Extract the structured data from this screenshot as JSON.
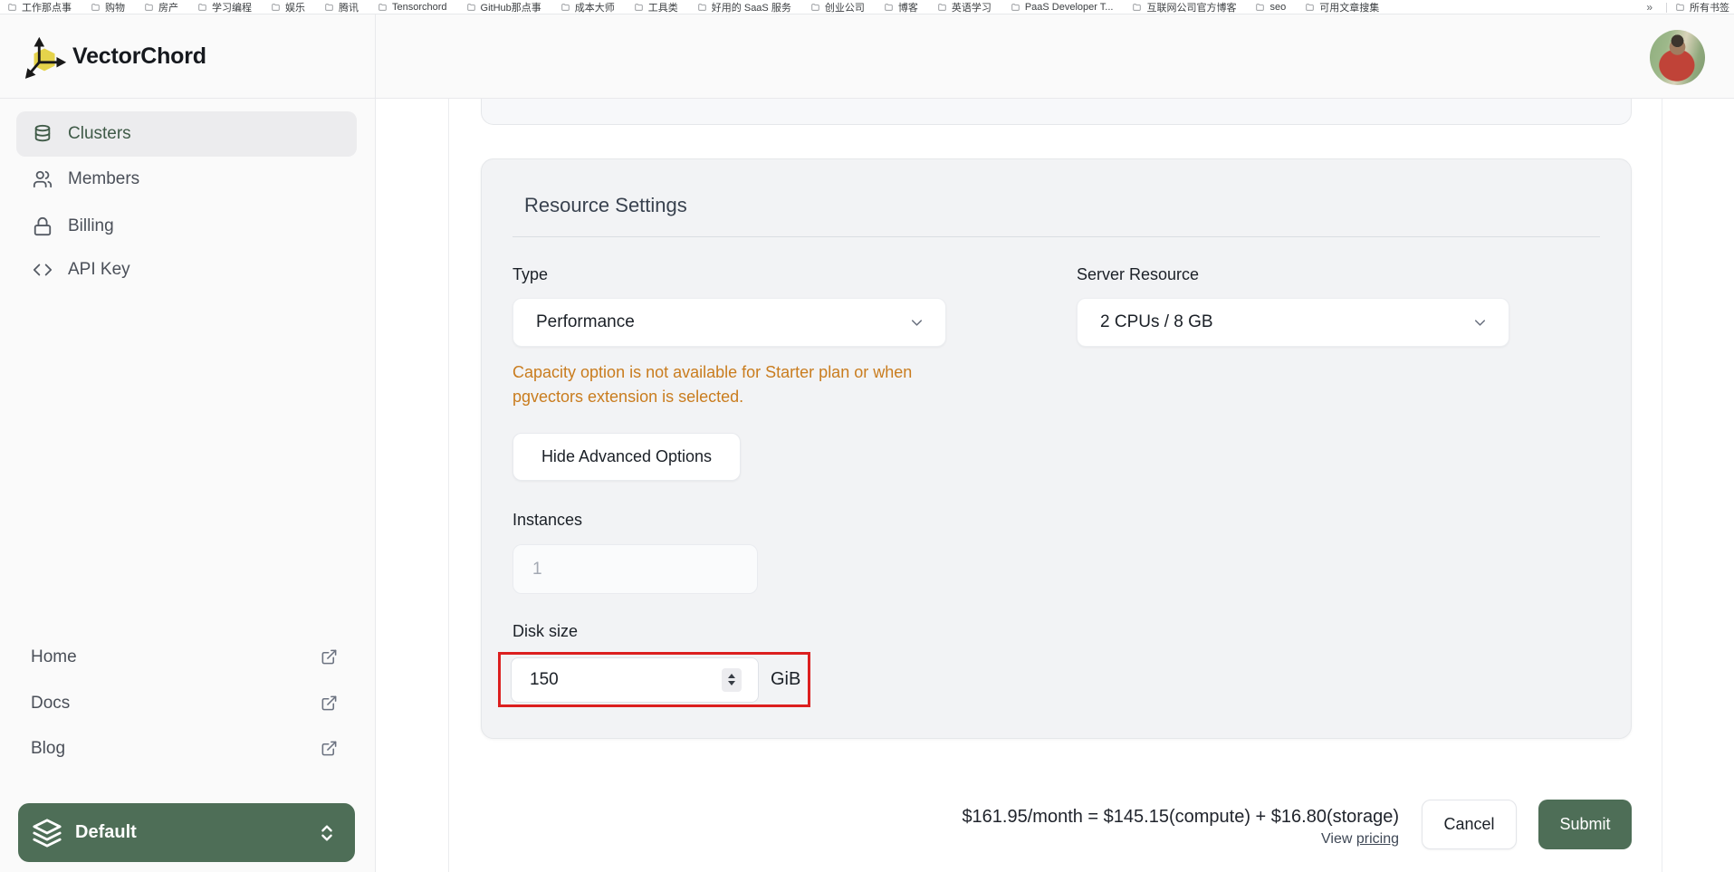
{
  "bookmarks": {
    "items": [
      "工作那点事",
      "购物",
      "房产",
      "学习编程",
      "娱乐",
      "腾讯",
      "Tensorchord",
      "GitHub那点事",
      "成本大师",
      "工具类",
      "好用的 SaaS 服务",
      "创业公司",
      "博客",
      "英语学习",
      "PaaS Developer T...",
      "互联网公司官方博客",
      "seo",
      "可用文章搜集"
    ],
    "overflow_chevron": "»",
    "all_bookmarks": "所有书签"
  },
  "sidebar": {
    "brand": "VectorChord",
    "nav": [
      {
        "label": "Clusters",
        "icon": "database-icon",
        "active": true
      },
      {
        "label": "Members",
        "icon": "users-icon",
        "active": false
      },
      {
        "label": "Billing",
        "icon": "lock-icon",
        "active": false
      },
      {
        "label": "API Key",
        "icon": "code-icon",
        "active": false
      }
    ],
    "links": [
      {
        "label": "Home",
        "icon": "external-link-icon"
      },
      {
        "label": "Docs",
        "icon": "external-link-icon"
      },
      {
        "label": "Blog",
        "icon": "external-link-icon"
      }
    ],
    "project_switcher": {
      "label": "Default",
      "icon": "layers-icon"
    }
  },
  "form": {
    "title": "Resource Settings",
    "type": {
      "label": "Type",
      "value": "Performance"
    },
    "server_resource": {
      "label": "Server Resource",
      "value": "2 CPUs / 8 GB"
    },
    "warning": "Capacity option is not available for Starter plan or when pgvectors extension is selected.",
    "advanced_button": "Hide Advanced Options",
    "instances": {
      "label": "Instances",
      "value": "1"
    },
    "disk_size": {
      "label": "Disk size",
      "value": "150",
      "unit": "GiB"
    }
  },
  "footer": {
    "price_summary": "$161.95/month = $145.15(compute) + $16.80(storage)",
    "view_label": "View ",
    "pricing_link": "pricing",
    "cancel": "Cancel",
    "submit": "Submit"
  },
  "colors": {
    "accent_green": "#4e6e57",
    "active_nav_green": "#3f5a47",
    "warning_orange": "#c97c1e",
    "annotation_red": "#dc1f1f",
    "card_bg": "#f2f3f5",
    "sidebar_bg": "#fafafa"
  }
}
